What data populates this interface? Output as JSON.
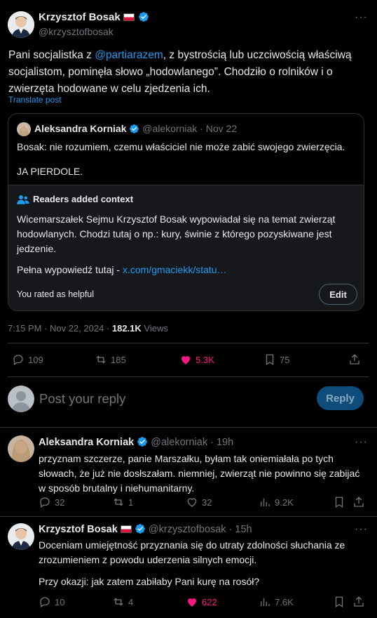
{
  "main_post": {
    "author_name": "Krzysztof Bosak",
    "handle": "@krzysztofbosak",
    "text_before": "Pani socjalistka z ",
    "mention": "@partiarazem",
    "text_after": ", z bystrością lub uczciwością właściwą socjalistom, pominęła słowo „hodowlanego”. Chodziło o rolników i o zwierzęta hodowane w celu zjedzenia ich.",
    "translate_label": "Translate post",
    "time": "7:15 PM · Nov 22, 2024 · ",
    "views_count": "182.1K",
    "views_label": "Views",
    "stats": {
      "replies": "109",
      "reposts": "185",
      "likes": "5.3K",
      "bookmarks": "75"
    }
  },
  "quote": {
    "author_name": "Aleksandra Korniak",
    "handle_date": "@alekorniak · Nov 22",
    "text_line1": "Bosak: nie rozumiem, czemu właściciel nie może zabić swojego zwierzęcia.",
    "text_line2": "JA PIERDOLE."
  },
  "context": {
    "title": "Readers added context",
    "body": "Wicemarszałek Sejmu Krzysztof Bosak wypowiadał się na temat zwierząt hodowlanych. Chodzi tutaj o np.: kury, świnie z którego pozyskiwane jest jedzenie.",
    "full_label": "Pełna wypowiedź tutaj - ",
    "full_link": "x.com/gmaciekk/statu…",
    "rated": "You rated as helpful",
    "edit_label": "Edit"
  },
  "compose": {
    "placeholder": "Post your reply",
    "reply_button": "Reply"
  },
  "replies": [
    {
      "author_name": "Aleksandra Korniak",
      "handle_time": "@alekorniak · 19h",
      "text": "przyznam szczerze, panie Marszałku, byłam tak oniemiałała po tych słowach, że już nie dosłszałam. niemniej, zwierząt nie powinno się zabijać w sposób brutalny i niehumanitarny.",
      "stats": {
        "replies": "32",
        "reposts": "1",
        "likes": "32",
        "views": "9.2K"
      }
    },
    {
      "author_name": "Krzysztof Bosak",
      "handle_time": "@krzysztofbosak · 15h",
      "text": "Doceniam umiejętność przyznania się do utraty zdolności słuchania ze zrozumieniem z powodu uderzenia silnych emocji.",
      "text2": "Przy okazji: jak zatem zabiłaby Pani kurę na rosół?",
      "stats": {
        "replies": "10",
        "reposts": "4",
        "likes": "622",
        "views": "7.6K"
      }
    }
  ],
  "colors": {
    "accent": "#1d9bf0",
    "like": "#f91880",
    "border": "#2f3336",
    "muted": "#71767b"
  }
}
